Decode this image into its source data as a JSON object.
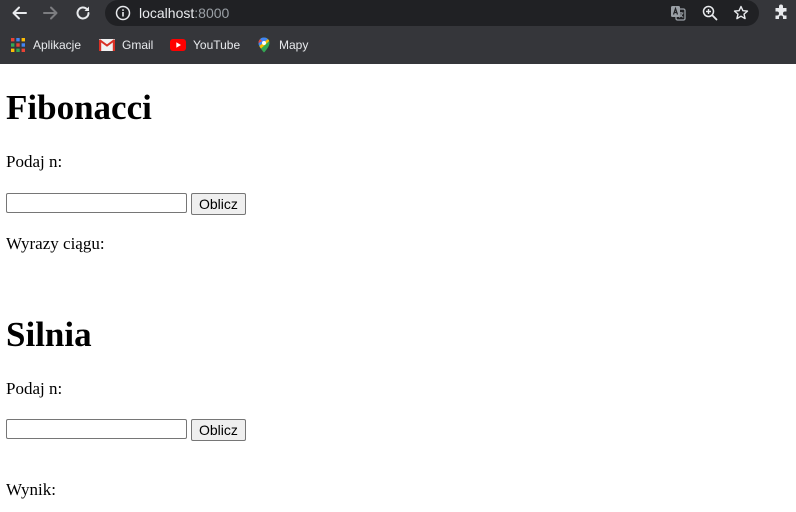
{
  "browser": {
    "url_host": "localhost",
    "url_port": ":8000",
    "icons": [
      "back-icon",
      "forward-icon",
      "reload-icon",
      "info-icon",
      "translate-icon",
      "zoom-icon",
      "star-icon",
      "extensions-icon"
    ],
    "bookmarks": [
      {
        "label": "Aplikacje",
        "icon": "apps-grid-icon"
      },
      {
        "label": "Gmail",
        "icon": "gmail-icon"
      },
      {
        "label": "YouTube",
        "icon": "youtube-icon"
      },
      {
        "label": "Mapy",
        "icon": "maps-pin-icon"
      }
    ]
  },
  "fibonacci": {
    "title": "Fibonacci",
    "prompt": "Podaj n:",
    "input_value": "",
    "button_label": "Oblicz",
    "result_label": "Wyrazy ciągu:"
  },
  "silnia": {
    "title": "Silnia",
    "prompt": "Podaj n:",
    "input_value": "",
    "button_label": "Oblicz",
    "result_label": "Wynik:"
  }
}
